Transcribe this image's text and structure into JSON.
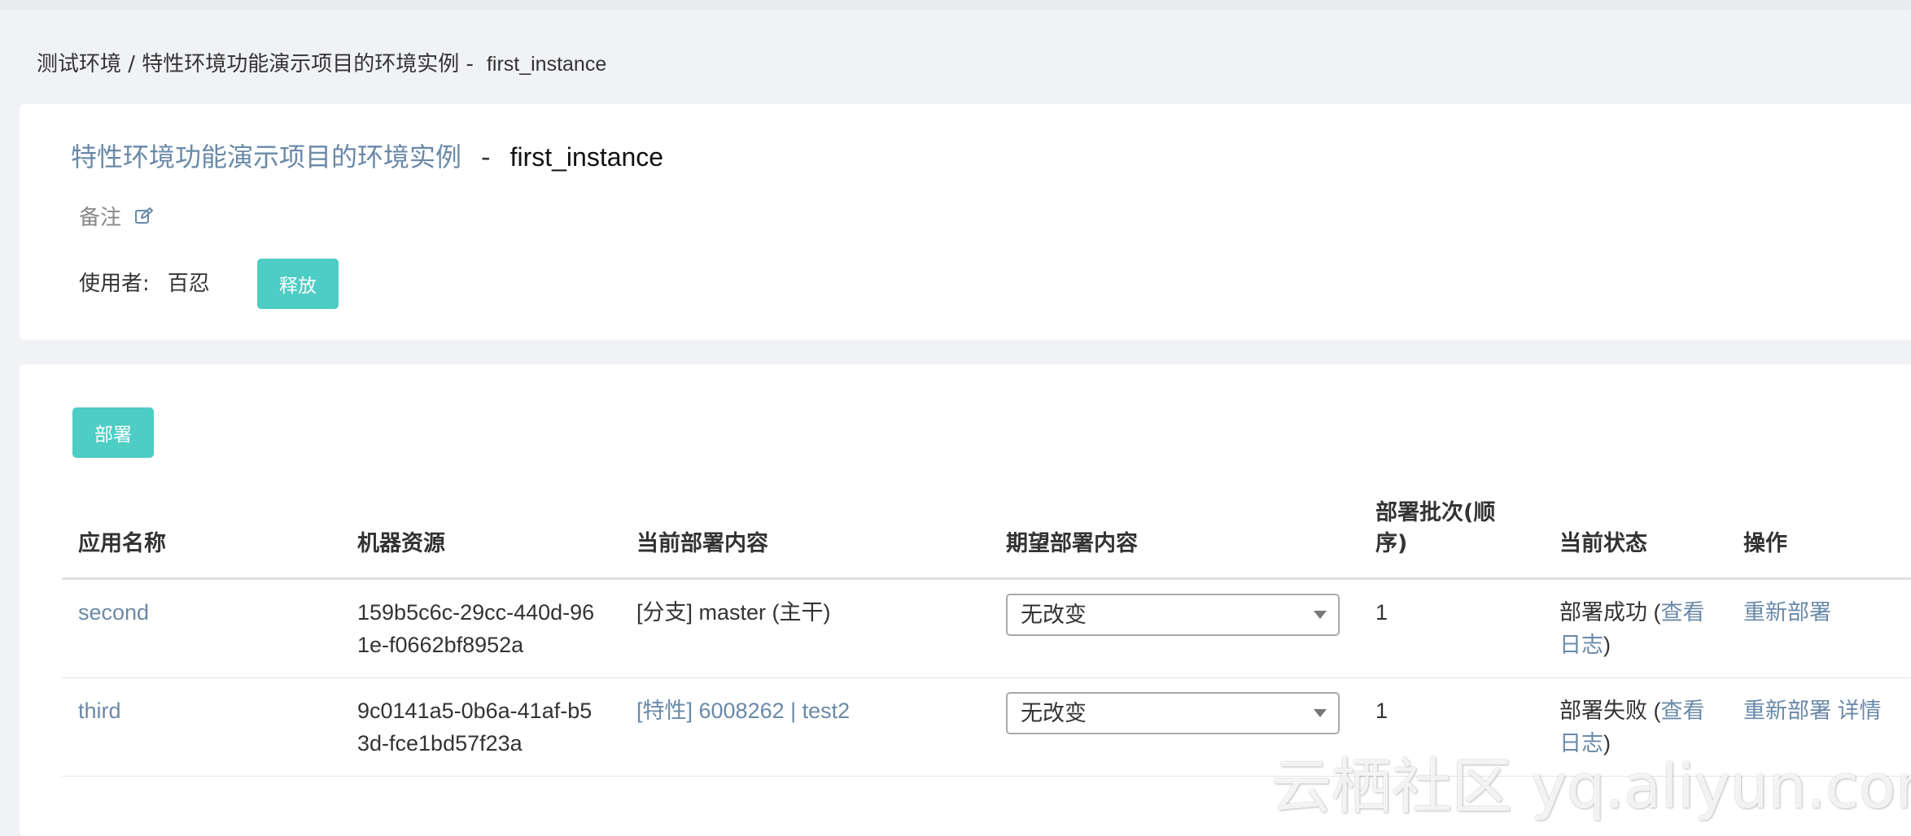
{
  "breadcrumb": {
    "path": "测试环境 / 特性环境功能演示项目的环境实例 -",
    "instance": "first_instance"
  },
  "header": {
    "project_title": "特性环境功能演示项目的环境实例",
    "separator": "-",
    "instance_name": "first_instance"
  },
  "note": {
    "label": "备注",
    "icon": "edit-icon"
  },
  "user": {
    "label": "使用者:",
    "name": "百忍",
    "release_button": "释放"
  },
  "deploy_button": "部署",
  "table": {
    "headers": [
      "应用名称",
      "机器资源",
      "当前部署内容",
      "期望部署内容",
      "部署批次(顺序)",
      "当前状态",
      "操作"
    ],
    "rows": [
      {
        "app": "second",
        "machine": "159b5c6c-29cc-440d-961e-f0662bf8952a",
        "current": "[分支] master (主干)",
        "expected": "无改变",
        "batch": "1",
        "status": "部署成功",
        "status_link": "查看日志",
        "actions": [
          "重新部署"
        ]
      },
      {
        "app": "third",
        "machine": "9c0141a5-0b6a-41af-b53d-fce1bd57f23a",
        "current": "[特性] 6008262 | test2",
        "expected": "无改变",
        "batch": "1",
        "status": "部署失败",
        "status_link": "查看日志",
        "actions": [
          "重新部署",
          "详情"
        ]
      }
    ]
  },
  "watermark": "云栖社区 yq.aliyun.com",
  "colors": {
    "accent": "#4ecdc4",
    "link": "#6a89a8",
    "background": "#f0f2f5"
  }
}
